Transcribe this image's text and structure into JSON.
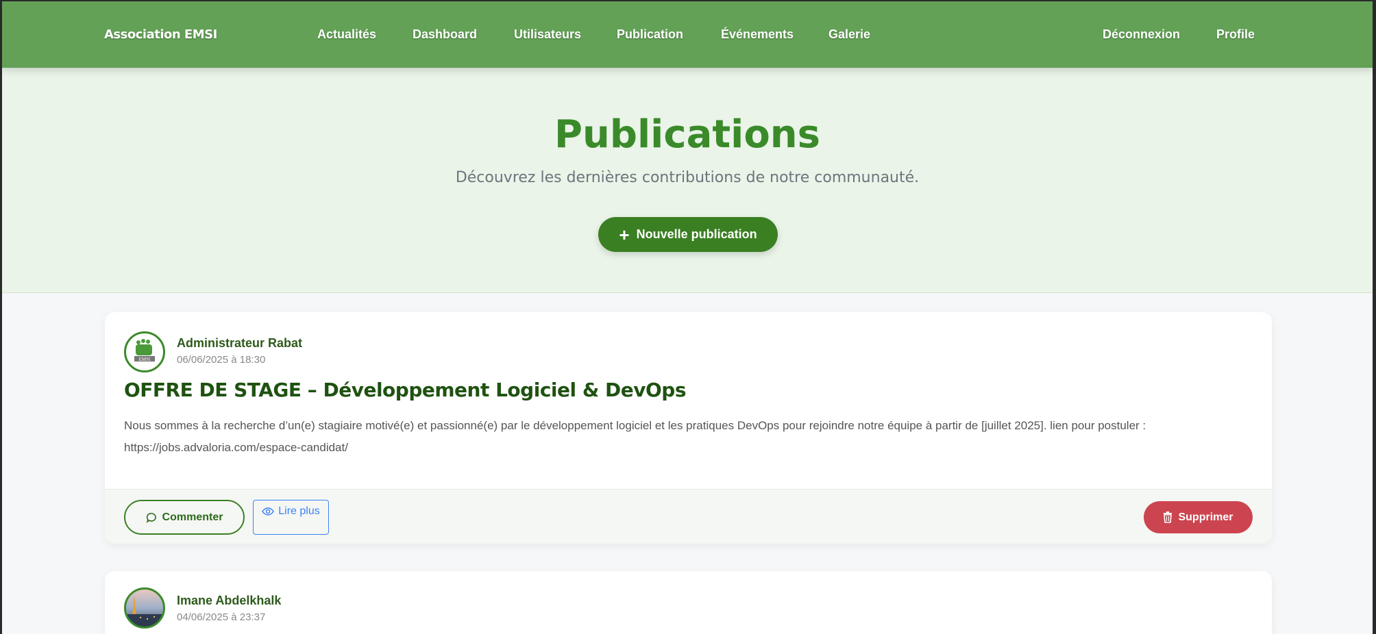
{
  "nav": {
    "brand": "Association EMSI",
    "items": [
      "Actualités",
      "Dashboard",
      "Utilisateurs",
      "Publication",
      "Événements",
      "Galerie"
    ],
    "logout": "Déconnexion",
    "profile": "Profile"
  },
  "hero": {
    "title": "Publications",
    "subtitle": "Découvrez les dernières contributions de notre communauté.",
    "new_button": "Nouvelle publication"
  },
  "posts": [
    {
      "author": "Administrateur Rabat",
      "date": "06/06/2025 à 18:30",
      "avatar_text": "EMSI",
      "title": "OFFRE DE STAGE – Développement Logiciel & DevOps",
      "body": "Nous sommes à la recherche d’un(e) stagiaire motivé(e) et passionné(e) par le développement logiciel et les pratiques DevOps pour rejoindre notre équipe à partir de [juillet 2025]. lien pour postuler : https://jobs.advaloria.com/espace-candidat/",
      "comment_label": "Commenter",
      "read_label": "Lire plus",
      "delete_label": "Supprimer"
    },
    {
      "author": "Imane Abdelkhalk",
      "date": "04/06/2025 à 23:37"
    }
  ],
  "colors": {
    "nav": "#63a256",
    "primary": "#3a7f22",
    "danger": "#cc444f",
    "link": "#3b82f6"
  }
}
